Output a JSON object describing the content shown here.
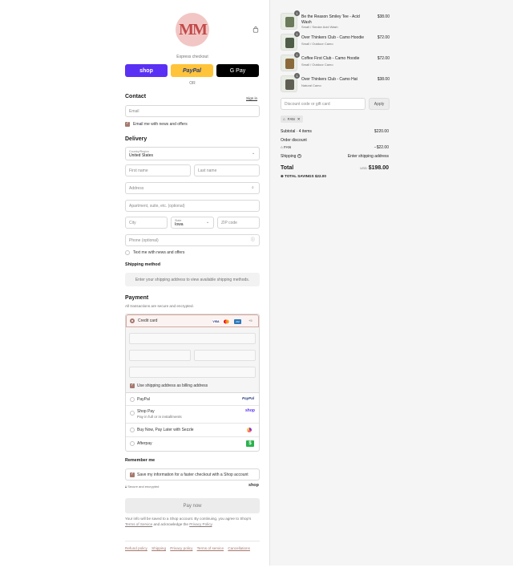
{
  "brand": {
    "logo_text": "MM"
  },
  "express": {
    "label": "Express checkout",
    "shop": "shop",
    "paypal": "PayPal",
    "gpay": "G Pay",
    "or": "OR"
  },
  "contact": {
    "heading": "Contact",
    "signin": "Sign in",
    "email_placeholder": "Email",
    "email_news": "Email me with news and offers"
  },
  "delivery": {
    "heading": "Delivery",
    "country_label": "Country/Region",
    "country_value": "United States",
    "first_name": "First name",
    "last_name": "Last name",
    "address": "Address",
    "apartment": "Apartment, suite, etc. (optional)",
    "city": "City",
    "state_label": "State",
    "state_value": "Iowa",
    "zip": "ZIP code",
    "phone": "Phone (optional)",
    "text_news": "Text me with news and offers"
  },
  "shipping": {
    "heading": "Shipping method",
    "message": "Enter your shipping address to view available shipping methods."
  },
  "payment": {
    "heading": "Payment",
    "subtitle": "All transactions are secure and encrypted.",
    "credit_card": "Credit card",
    "card_more": "+5",
    "billing_same": "Use shipping address as billing address",
    "methods": [
      {
        "label": "PayPal",
        "sub": "",
        "logo": "PayPal"
      },
      {
        "label": "Shop Pay",
        "sub": "Pay in full or in installments",
        "logo": "shop"
      },
      {
        "label": "Buy Now, Pay Later with Sezzle",
        "sub": "",
        "logo": "sezzle"
      },
      {
        "label": "Afterpay",
        "sub": "",
        "logo": "$"
      }
    ]
  },
  "remember": {
    "heading": "Remember me",
    "save_info": "Save my information for a faster checkout with a Shop account",
    "secure": "Secure and encrypted",
    "shop": "shop"
  },
  "pay_now": "Pay now",
  "legal": {
    "pre": "Your info will be saved to a Shop account. By continuing, you agree to Shop's ",
    "tos": "Terms of Service",
    "mid": " and acknowledge the ",
    "privacy": "Privacy Policy",
    "post": "."
  },
  "policies": [
    "Refund policy",
    "Shipping",
    "Privacy policy",
    "Terms of service",
    "Cancellations"
  ],
  "cart": {
    "items": [
      {
        "name": "Be the Reason Smiley Tee - Acid Wash",
        "variant": "Small / Smoke Acid Wash",
        "price": "$38.00",
        "qty": "1",
        "color": "#6b7a5a"
      },
      {
        "name": "Over Thinkers Club - Camo Hoodie",
        "variant": "Small / Outdoor Camo",
        "price": "$72.00",
        "qty": "1",
        "color": "#4f5d48"
      },
      {
        "name": "Coffee First Club - Camo Hoodie",
        "variant": "Small / Outdoor Camo",
        "price": "$72.00",
        "qty": "1",
        "color": "#8a6a3c"
      },
      {
        "name": "Over Thinkers Club - Camo Hat",
        "variant": "Natural Camo",
        "price": "$38.00",
        "qty": "1",
        "color": "#5f5f55"
      }
    ],
    "discount_placeholder": "Discount code or gift card",
    "apply": "Apply",
    "code": "FAN",
    "subtotal_label": "Subtotal · 4 items",
    "subtotal": "$220.00",
    "order_discount": "Order discount",
    "discount_code": "FAN",
    "discount_value": "−$22.00",
    "shipping_label": "Shipping",
    "shipping_value": "Enter shipping address",
    "total_label": "Total",
    "currency": "USD",
    "total": "$198.00",
    "savings_label": "TOTAL SAVINGS",
    "savings": "$22.00"
  }
}
